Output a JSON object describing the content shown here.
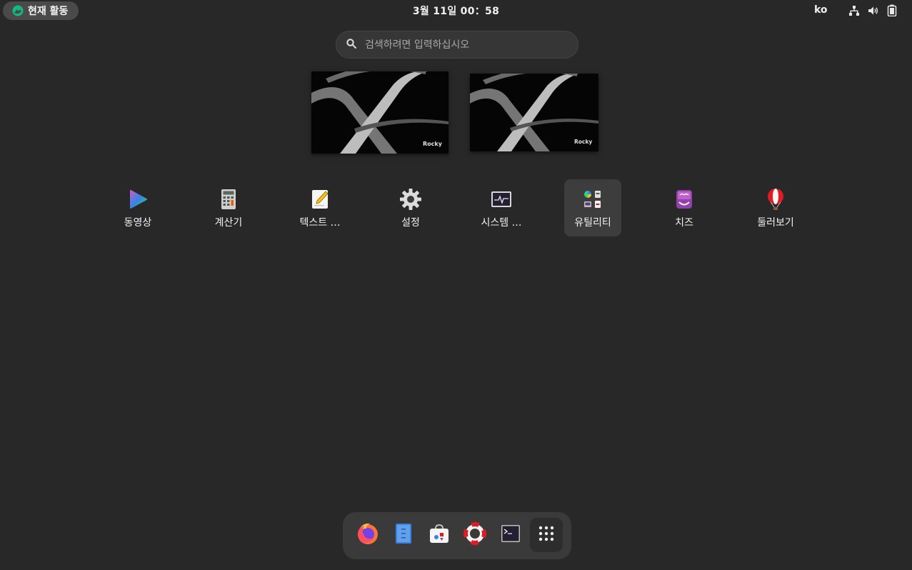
{
  "topbar": {
    "activities_label": "현재 활동",
    "clock": "3월 11일  00：58",
    "language": "ko",
    "tray_icons": [
      "network-icon",
      "volume-icon",
      "battery-icon"
    ]
  },
  "search": {
    "placeholder": "검색하려면 입력하십시오",
    "value": ""
  },
  "workspaces": [
    {
      "watermark": "Rocky"
    },
    {
      "watermark": "Rocky"
    }
  ],
  "apps": [
    {
      "label": "동영상",
      "icon": "videos-icon"
    },
    {
      "label": "계산기",
      "icon": "calculator-icon"
    },
    {
      "label": "텍스트 …",
      "icon": "text-editor-icon"
    },
    {
      "label": "설정",
      "icon": "settings-gear-icon"
    },
    {
      "label": "시스템 …",
      "icon": "system-monitor-icon"
    },
    {
      "label": "유틸리티",
      "icon": "utilities-folder-icon",
      "selected": true
    },
    {
      "label": "치즈",
      "icon": "cheese-icon"
    },
    {
      "label": "둘러보기",
      "icon": "tour-balloon-icon"
    }
  ],
  "dock": [
    "firefox-icon",
    "files-icon",
    "software-icon",
    "help-icon",
    "terminal-icon",
    "show-apps-icon"
  ],
  "colors": {
    "background": "#282828",
    "topbar_pill": "#4a4a4a",
    "search_bg": "#363636",
    "dock_bg": "#3a3a3a",
    "selected_tile": "#3d3d3d",
    "rocky_green": "#10b981"
  }
}
